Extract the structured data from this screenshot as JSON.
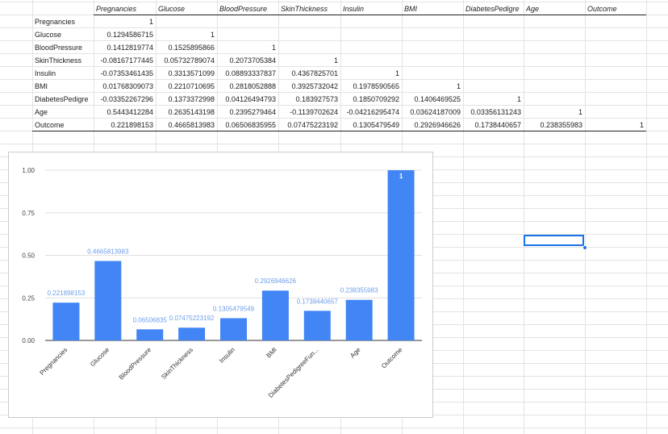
{
  "spreadsheet": {
    "column_headers": [
      "Pregnancies",
      "Glucose",
      "BloodPressure",
      "SkinThickness",
      "Insulin",
      "BMI",
      "DiabetesPedigre",
      "Age",
      "Outcome"
    ],
    "rows": [
      {
        "label": "Pregnancies",
        "values": [
          "1",
          "",
          "",
          "",
          "",
          "",
          "",
          "",
          ""
        ]
      },
      {
        "label": "Glucose",
        "values": [
          "0.1294586715",
          "1",
          "",
          "",
          "",
          "",
          "",
          "",
          ""
        ]
      },
      {
        "label": "BloodPressure",
        "values": [
          "0.1412819774",
          "0.1525895866",
          "1",
          "",
          "",
          "",
          "",
          "",
          ""
        ]
      },
      {
        "label": "SkinThickness",
        "values": [
          "-0.08167177445",
          "0.05732789074",
          "0.2073705384",
          "1",
          "",
          "",
          "",
          "",
          ""
        ]
      },
      {
        "label": "Insulin",
        "values": [
          "-0.07353461435",
          "0.3313571099",
          "0.08893337837",
          "0.4367825701",
          "1",
          "",
          "",
          "",
          ""
        ]
      },
      {
        "label": "BMI",
        "values": [
          "0.01768309073",
          "0.2210710695",
          "0.2818052888",
          "0.3925732042",
          "0.1978590565",
          "1",
          "",
          "",
          ""
        ]
      },
      {
        "label": "DiabetesPedigre",
        "values": [
          "-0.03352267296",
          "0.1373372998",
          "0.04126494793",
          "0.183927573",
          "0.1850709292",
          "0.1406469525",
          "1",
          "",
          ""
        ]
      },
      {
        "label": "Age",
        "values": [
          "0.5443412284",
          "0.2635143198",
          "0.2395279464",
          "-0.1139702624",
          "-0.04216295474",
          "0.03624187009",
          "0.03356131243",
          "1",
          ""
        ]
      },
      {
        "label": "Outcome",
        "values": [
          "0.221898153",
          "0.4665813983",
          "0.06506835955",
          "0.07475223192",
          "0.1305479549",
          "0.2926946626",
          "0.1738440657",
          "0.238355983",
          "1"
        ]
      }
    ]
  },
  "chart_data": {
    "type": "bar",
    "categories": [
      "Pregnancies",
      "Glucose",
      "BloodPressure",
      "SkinThickness",
      "Insulin",
      "BMI",
      "DiabetesPedigreeFun...",
      "Age",
      "Outcome"
    ],
    "values": [
      0.221898153,
      0.4665813983,
      0.06506835955,
      0.07475223192,
      0.1305479549,
      0.2926946626,
      0.1738440657,
      0.238355983,
      1
    ],
    "data_labels": [
      "0.221898153",
      "0.4665813983",
      "0.06506835",
      "0.07475223192",
      "0.1305479549",
      "0.2926946626",
      "0.1738440657",
      "0.238355983",
      "1"
    ],
    "y_ticks": [
      "0.00",
      "0.25",
      "0.50",
      "0.75",
      "1.00"
    ],
    "ylim": [
      0,
      1
    ],
    "grid": true,
    "title": "",
    "xlabel": "",
    "ylabel": "",
    "bar_color": "#4285f4",
    "data_label_color": "#6d9eeb",
    "last_label_color": "#ffffff"
  },
  "colors": {
    "gridline": "#e2e3e3",
    "selection": "#1a73e8",
    "text": "#202124"
  }
}
